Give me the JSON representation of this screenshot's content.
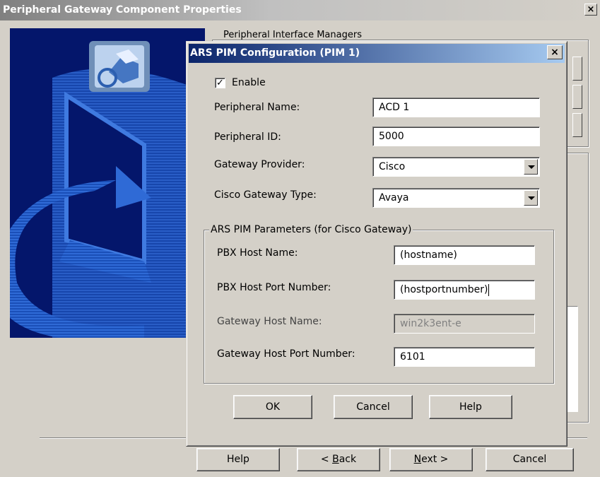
{
  "outer_window": {
    "title": "Peripheral Gateway Component Properties",
    "close_glyph": "×",
    "groupbox_label": "Peripheral Interface Managers",
    "buttons": {
      "help": "Help",
      "back_prefix": "< ",
      "back_mnemonic": "B",
      "back_rest": "ack",
      "next_mnemonic": "N",
      "next_rest": "ext >",
      "cancel": "Cancel"
    }
  },
  "dialog": {
    "title": "ARS PIM Configuration (PIM 1)",
    "close_glyph": "×",
    "enable": {
      "label": "Enable",
      "checked": true,
      "check_glyph": "✓"
    },
    "peripheral_name": {
      "label": "Peripheral Name:",
      "value": "ACD 1"
    },
    "peripheral_id": {
      "label": "Peripheral ID:",
      "value": "5000"
    },
    "gateway_provider": {
      "label": "Gateway Provider:",
      "value": "Cisco"
    },
    "cisco_gateway_type": {
      "label": "Cisco Gateway Type:",
      "value": "Avaya"
    },
    "ars_group": {
      "label": "ARS PIM Parameters (for Cisco Gateway)",
      "pbx_host_name": {
        "label": "PBX Host Name:",
        "value": "(hostname)"
      },
      "pbx_host_port": {
        "label": "PBX Host Port Number:",
        "value": "(hostportnumber)"
      },
      "gateway_host_name": {
        "label": "Gateway Host Name:",
        "value": "win2k3ent-e",
        "disabled": true
      },
      "gateway_host_port": {
        "label": "Gateway Host Port Number:",
        "value": "6101"
      }
    },
    "buttons": {
      "ok": "OK",
      "cancel": "Cancel",
      "help": "Help"
    }
  },
  "colors": {
    "face": "#d4d0c8",
    "active_title_start": "#0a246a",
    "active_title_end": "#a6caf0",
    "banner": "#04166b"
  },
  "icons": [
    "close-icon",
    "checkbox-check-icon",
    "dropdown-arrow-icon",
    "setup-banner-icon"
  ]
}
